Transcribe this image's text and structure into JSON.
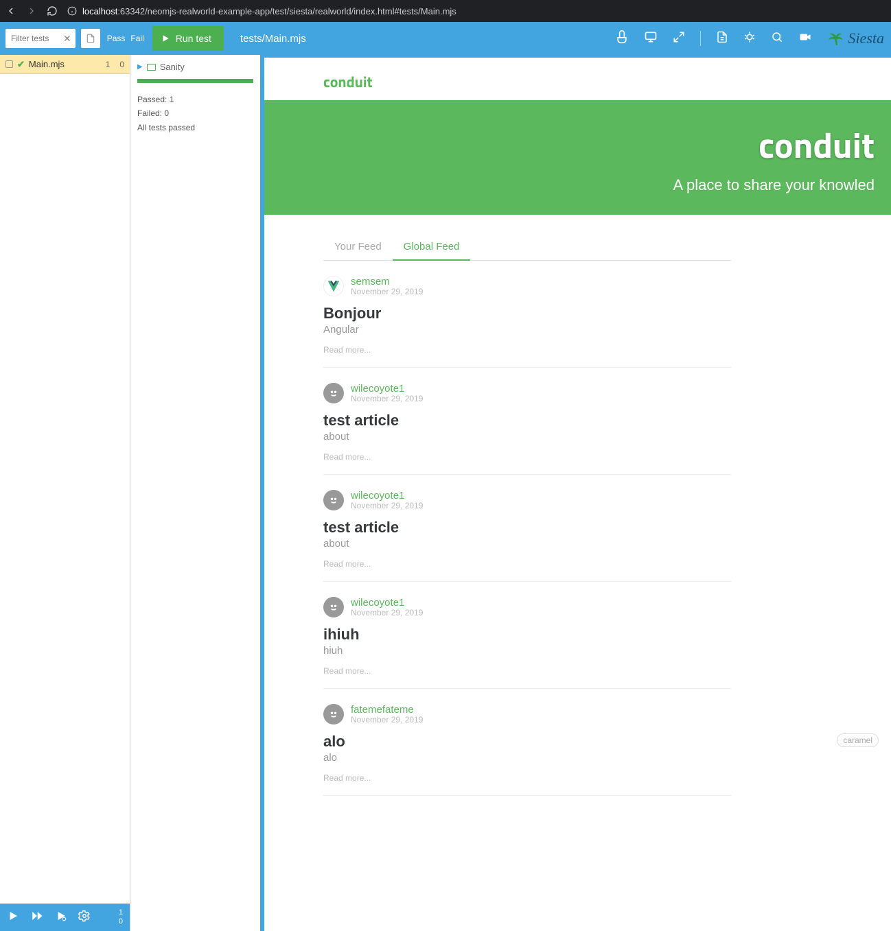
{
  "browser": {
    "url_prefix": "localhost",
    "url_rest": ":63342/neomjs-realworld-example-app/test/siesta/realworld/index.html#tests/Main.mjs"
  },
  "toolbar": {
    "filter_placeholder": "Filter tests",
    "pass": "Pass",
    "fail": "Fail",
    "run": "Run test",
    "path": "tests/Main.mjs",
    "logo": "Siesta"
  },
  "left": {
    "file": "Main.mjs",
    "count_pass": "1",
    "count_fail": "0",
    "bottom_pass": "1",
    "bottom_fail": "0"
  },
  "mid": {
    "group": "Sanity",
    "passed": "Passed: 1",
    "failed": "Failed: 0",
    "summary": "All tests passed"
  },
  "app": {
    "brand": "conduit",
    "hero_title": "conduit",
    "hero_sub": "A place to share your knowled",
    "tabs": {
      "your": "Your Feed",
      "global": "Global Feed"
    },
    "readmore": "Read more...",
    "tag": "caramel",
    "articles": [
      {
        "author": "semsem",
        "date": "November 29, 2019",
        "title": "Bonjour",
        "desc": "Angular",
        "avatar": "vue"
      },
      {
        "author": "wilecoyote1",
        "date": "November 29, 2019",
        "title": "test article",
        "desc": "about",
        "avatar": "face"
      },
      {
        "author": "wilecoyote1",
        "date": "November 29, 2019",
        "title": "test article",
        "desc": "about",
        "avatar": "face"
      },
      {
        "author": "wilecoyote1",
        "date": "November 29, 2019",
        "title": "ihiuh",
        "desc": "hiuh",
        "avatar": "face"
      },
      {
        "author": "fatemefateme",
        "date": "November 29, 2019",
        "title": "alo",
        "desc": "alo",
        "avatar": "face"
      }
    ]
  }
}
